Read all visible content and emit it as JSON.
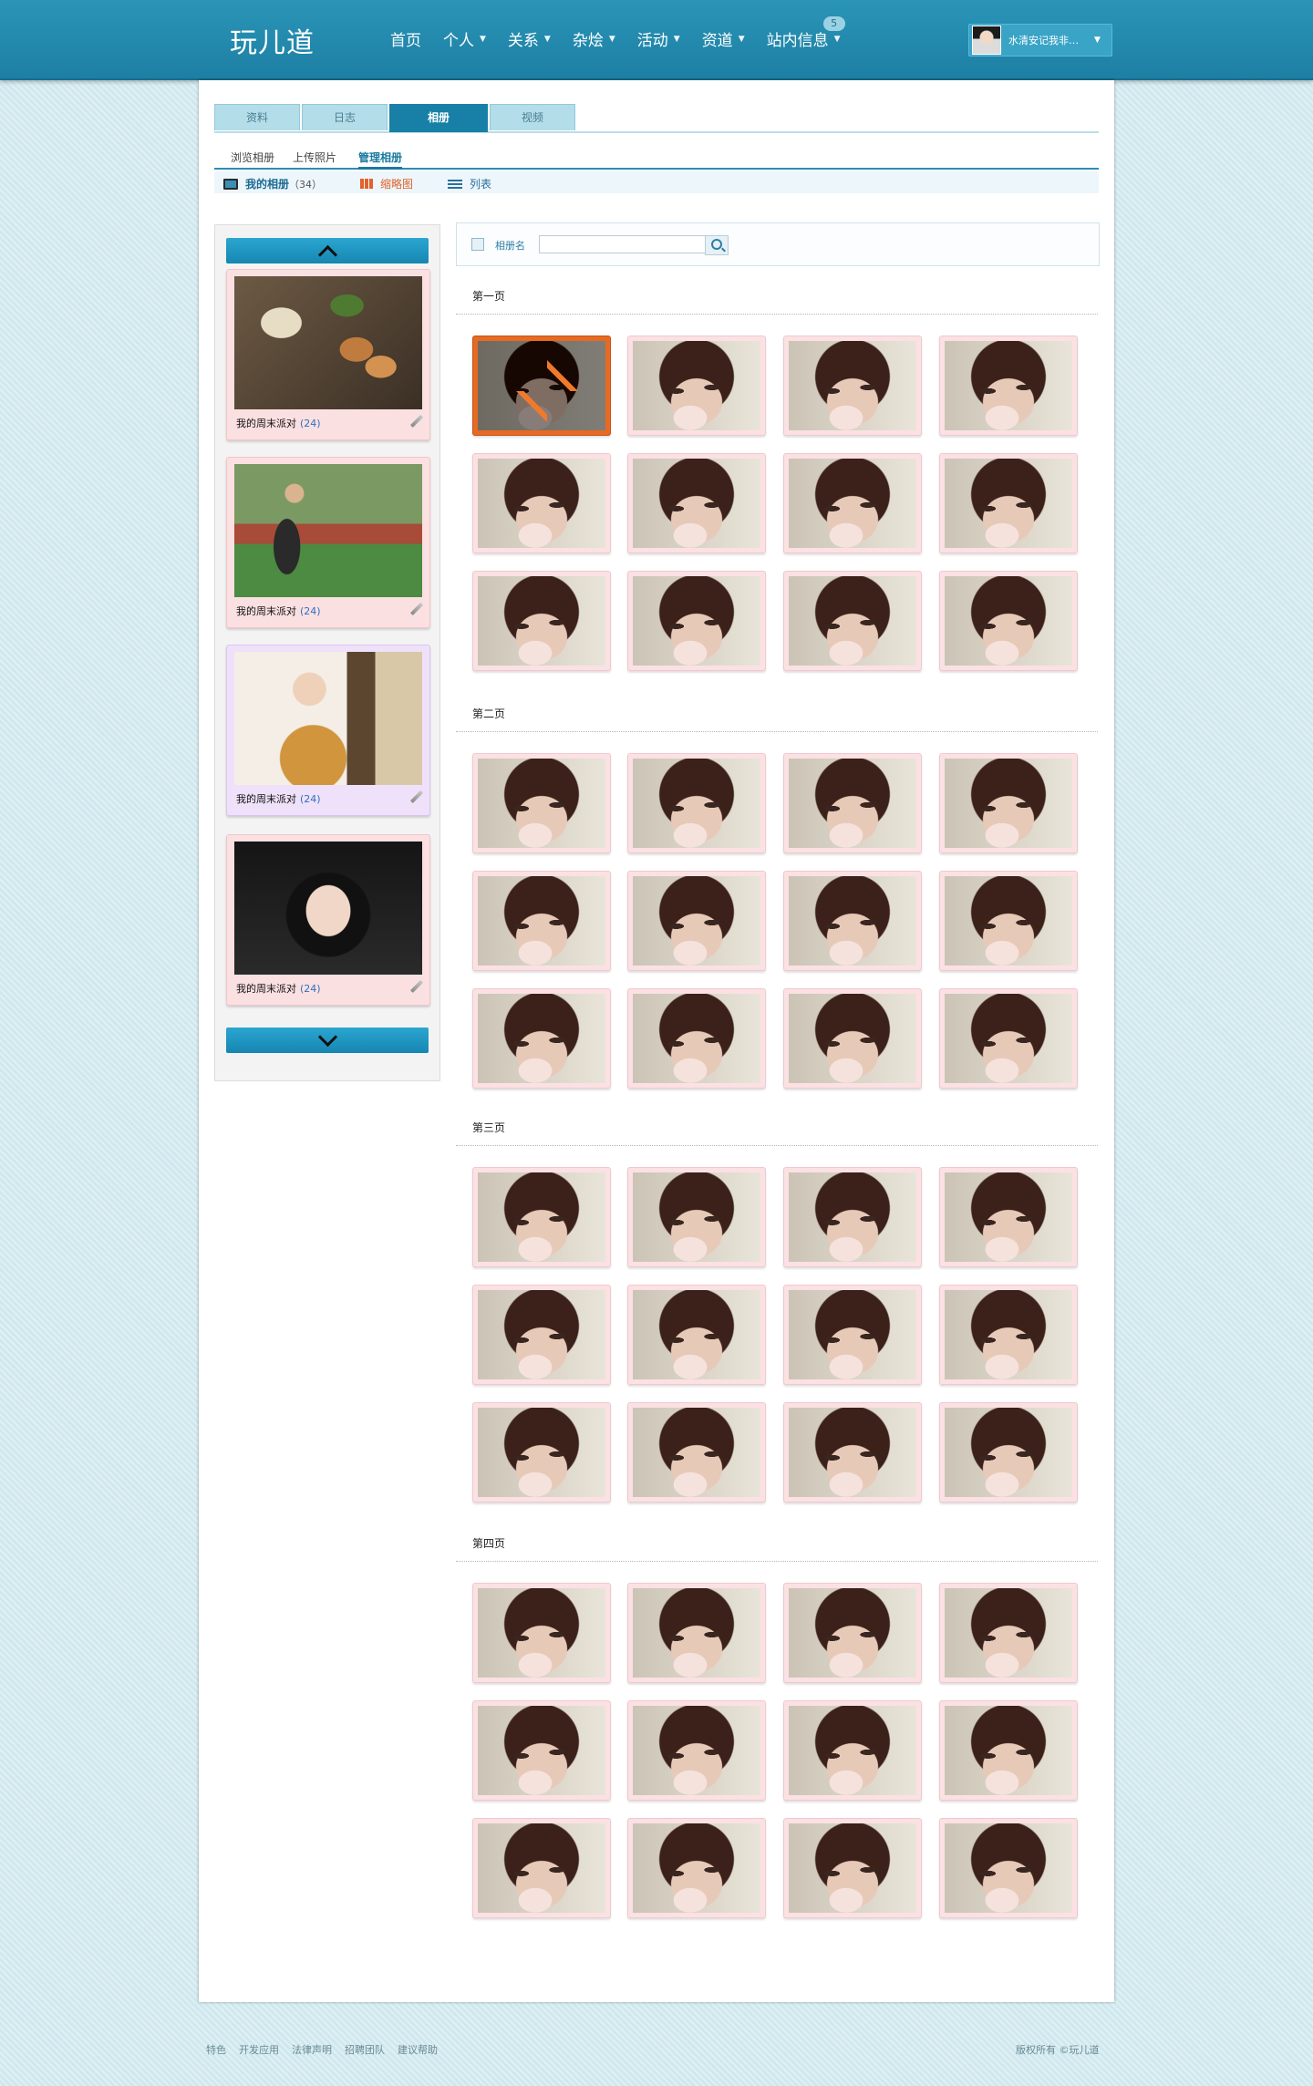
{
  "header": {
    "logo": "玩儿道",
    "nav": [
      {
        "label": "首页",
        "caret": false
      },
      {
        "label": "个人",
        "caret": true
      },
      {
        "label": "关系",
        "caret": true
      },
      {
        "label": "杂烩",
        "caret": true
      },
      {
        "label": "活动",
        "caret": true
      },
      {
        "label": "资道",
        "caret": true
      },
      {
        "label": "站内信息",
        "caret": true,
        "badge": "5"
      }
    ],
    "user": {
      "name": "水清安记我非…"
    }
  },
  "tabs": [
    {
      "label": "资料",
      "active": false
    },
    {
      "label": "日志",
      "active": false
    },
    {
      "label": "相册",
      "active": true
    },
    {
      "label": "视频",
      "active": false
    }
  ],
  "subtabs": [
    {
      "label": "浏览相册",
      "active": false
    },
    {
      "label": "上传照片",
      "active": false
    },
    {
      "label": "管理相册",
      "active": true
    }
  ],
  "toolbar": {
    "my_albums_label": "我的相册",
    "my_albums_count": "（34）",
    "thumbnail_label": "缩略图",
    "list_label": "列表"
  },
  "albums": [
    {
      "name": "我的周末派对",
      "count": "(24)",
      "photo": "food",
      "bg": "pink"
    },
    {
      "name": "我的周末派对",
      "count": "(24)",
      "photo": "track",
      "bg": "pink"
    },
    {
      "name": "我的周末派对",
      "count": "(24)",
      "photo": "coat",
      "bg": "violet"
    },
    {
      "name": "我的周末派对",
      "count": "(24)",
      "photo": "dark",
      "bg": "pink"
    }
  ],
  "search": {
    "label": "相册名",
    "value": "",
    "placeholder": ""
  },
  "pages": [
    {
      "label": "第一页",
      "photos": 12,
      "selected_index": 0
    },
    {
      "label": "第二页",
      "photos": 12
    },
    {
      "label": "第三页",
      "photos": 12
    },
    {
      "label": "第四页",
      "photos": 12
    }
  ],
  "footer": {
    "links": [
      "特色",
      "开发应用",
      "法律声明",
      "招聘团队",
      "建议帮助"
    ],
    "copyright": "版权所有 ©玩儿道"
  },
  "colors": {
    "header": "#2290b3",
    "accent": "#1880a6",
    "thumb_bg": "#fbe1e3",
    "selected": "#e66a22"
  }
}
